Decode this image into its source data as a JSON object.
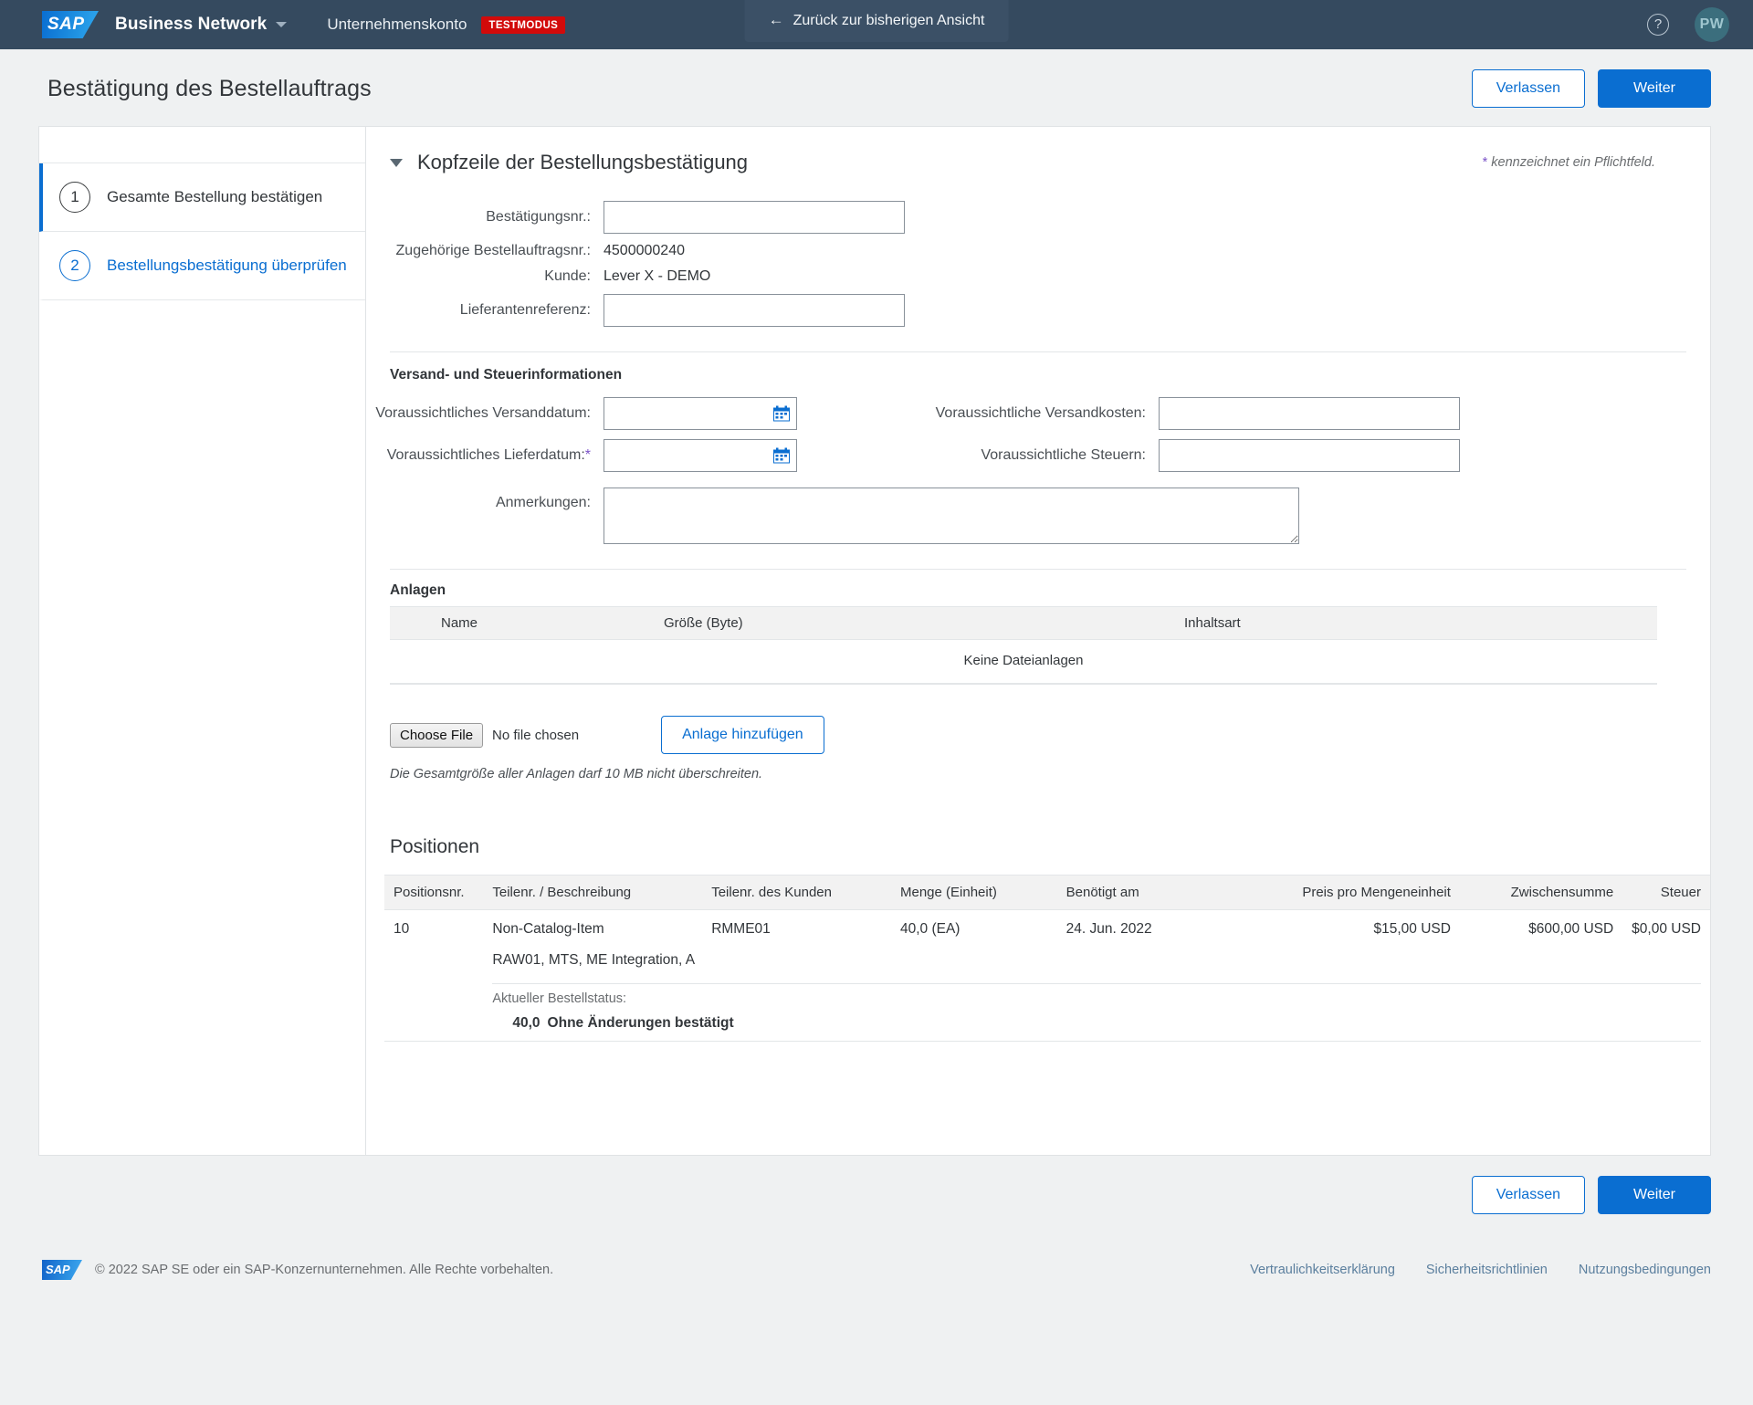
{
  "topnav": {
    "logo_text": "SAP",
    "product": "Business Network",
    "account": "Unternehmenskonto",
    "test_badge": "TESTMODUS",
    "back_button": "Zurück zur bisherigen Ansicht",
    "back_arrow": "←",
    "help_glyph": "?",
    "avatar_initials": "PW",
    "accent_color": "#354a5f",
    "badge_color": "#d20a0a"
  },
  "page": {
    "title": "Bestätigung des Bestellauftrags",
    "leave_label": "Verlassen",
    "next_label": "Weiter"
  },
  "sidebar": {
    "steps": [
      {
        "num": "1",
        "label": "Gesamte Bestellung bestätigen"
      },
      {
        "num": "2",
        "label": "Bestellungsbestätigung überprüfen"
      }
    ]
  },
  "header_section": {
    "title": "Kopfzeile der Bestellungsbestätigung",
    "required_star": "*",
    "required_note": "kennzeichnet ein Pflichtfeld.",
    "fields": {
      "confirmation_no_label": "Bestätigungsnr.:",
      "confirmation_no_value": "",
      "po_no_label": "Zugehörige Bestellauftragsnr.:",
      "po_no_value": "4500000240",
      "customer_label": "Kunde:",
      "customer_value": "Lever X - DEMO",
      "supplier_ref_label": "Lieferantenreferenz:",
      "supplier_ref_value": ""
    }
  },
  "shipping_section": {
    "title": "Versand- und Steuerinformationen",
    "est_ship_date_label": "Voraussichtliches Versanddatum:",
    "est_ship_date_value": "",
    "est_delivery_date_label": "Voraussichtliches Lieferdatum:",
    "est_delivery_date_required": "*",
    "est_delivery_date_value": "",
    "est_shipping_cost_label": "Voraussichtliche Versandkosten:",
    "est_shipping_cost_value": "",
    "est_tax_label": "Voraussichtliche Steuern:",
    "est_tax_value": "",
    "comments_label": "Anmerkungen:",
    "comments_value": ""
  },
  "attachments": {
    "title": "Anlagen",
    "columns": [
      "Name",
      "Größe (Byte)",
      "Inhaltsart"
    ],
    "empty_text": "Keine Dateianlagen",
    "choose_file_label": "Choose File",
    "no_file_text": "No file chosen",
    "add_attachment_label": "Anlage hinzufügen",
    "size_note": "Die Gesamtgröße aller Anlagen darf 10 MB nicht überschreiten."
  },
  "positions": {
    "title": "Positionen",
    "columns": [
      "Positionsnr.",
      "Teilenr. / Beschreibung",
      "Teilenr. des Kunden",
      "Menge (Einheit)",
      "Benötigt am",
      "Preis pro Mengeneinheit",
      "Zwischensumme",
      "Steuer"
    ],
    "rows": [
      {
        "position_no": "10",
        "part_description": "Non-Catalog-Item",
        "description_line2": "RAW01, MTS, ME Integration, A",
        "customer_part_no": "RMME01",
        "quantity": "40,0 (EA)",
        "need_by": "24. Jun. 2022",
        "unit_price": "$15,00 USD",
        "subtotal": "$600,00 USD",
        "tax": "$0,00 USD",
        "status_label": "Aktueller Bestellstatus:",
        "status_qty": "40,0",
        "status_text": "Ohne Änderungen bestätigt"
      }
    ]
  },
  "footer": {
    "logo_text": "SAP",
    "copyright": "© 2022 SAP SE oder ein SAP-Konzernunternehmen. Alle Rechte vorbehalten.",
    "links": [
      "Vertraulichkeitserklärung",
      "Sicherheitsrichtlinien",
      "Nutzungsbedingungen"
    ]
  }
}
